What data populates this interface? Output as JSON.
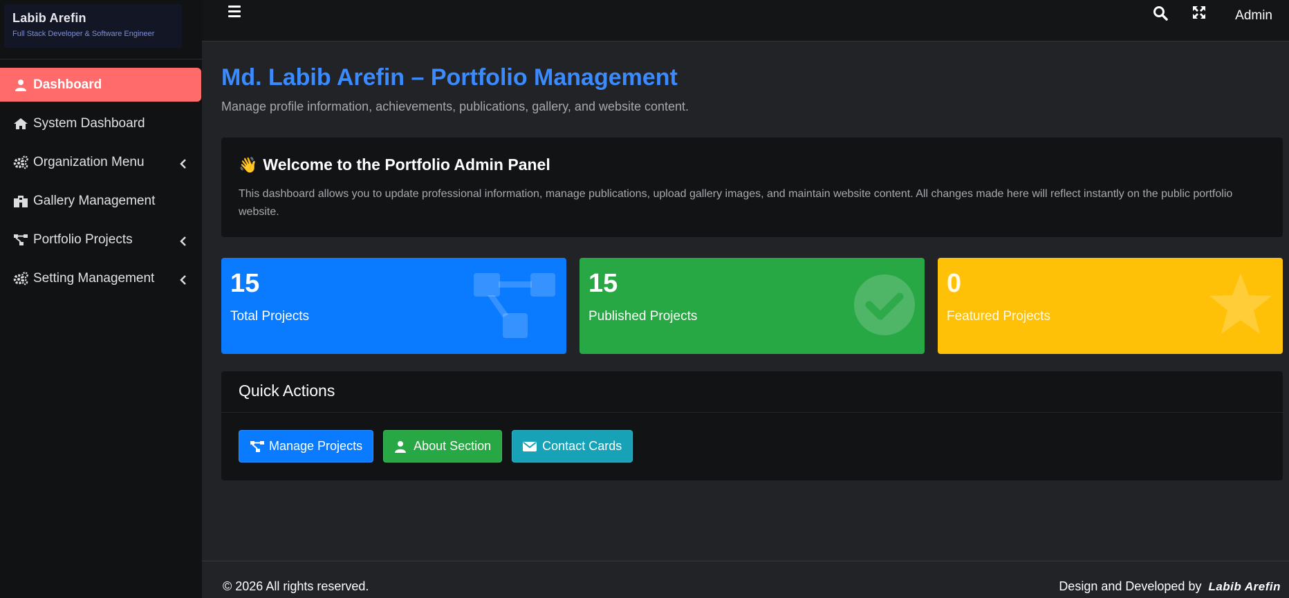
{
  "brand": {
    "name": "Labib Arefin",
    "subtitle": "Full Stack Developer & Software Engineer"
  },
  "sidebar": {
    "items": [
      {
        "label": "Dashboard",
        "icon": "user-icon",
        "active": true,
        "has_submenu": false
      },
      {
        "label": "System Dashboard",
        "icon": "home-icon",
        "active": false,
        "has_submenu": false
      },
      {
        "label": "Organization Menu",
        "icon": "cogs-icon",
        "active": false,
        "has_submenu": true
      },
      {
        "label": "Gallery Management",
        "icon": "building-icon",
        "active": false,
        "has_submenu": false
      },
      {
        "label": "Portfolio Projects",
        "icon": "sitemap-icon",
        "active": false,
        "has_submenu": true
      },
      {
        "label": "Setting Management",
        "icon": "cogs-icon",
        "active": false,
        "has_submenu": true
      }
    ]
  },
  "topbar": {
    "user": "Admin"
  },
  "main": {
    "title": "Md. Labib Arefin – Portfolio Management",
    "subtitle": "Manage profile information, achievements, publications, gallery, and website content.",
    "welcome": {
      "emoji": "👋",
      "title": "Welcome to the Portfolio Admin Panel",
      "text": "This dashboard allows you to update professional information, manage publications, upload gallery images, and maintain website content. All changes made here will reflect instantly on the public portfolio website."
    },
    "stats": [
      {
        "value": "15",
        "label": "Total Projects",
        "color": "#0a7bff",
        "icon": "sitemap-icon"
      },
      {
        "value": "15",
        "label": "Published Projects",
        "color": "#28a745",
        "icon": "check-circle-icon"
      },
      {
        "value": "0",
        "label": "Featured Projects",
        "color": "#ffc107",
        "icon": "star-icon"
      }
    ],
    "quick_actions": {
      "title": "Quick Actions",
      "buttons": [
        {
          "label": "Manage Projects",
          "icon": "sitemap-icon",
          "color": "#0a7bff"
        },
        {
          "label": "About Section",
          "icon": "user-icon",
          "color": "#28a745"
        },
        {
          "label": "Contact Cards",
          "icon": "envelope-icon",
          "color": "#17a2b8"
        }
      ]
    }
  },
  "footer": {
    "left": "© 2026  All rights reserved.",
    "right_prefix": "Design and Developed by",
    "signature": "Labib Arefin"
  }
}
